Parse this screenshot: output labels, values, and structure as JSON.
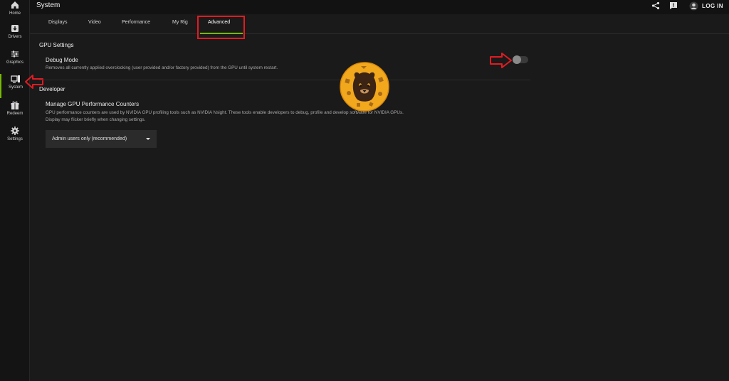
{
  "sidebar": {
    "items": [
      {
        "label": "Home",
        "icon": "home-icon"
      },
      {
        "label": "Drivers",
        "icon": "drivers-icon"
      },
      {
        "label": "Graphics",
        "icon": "sliders-icon"
      },
      {
        "label": "System",
        "icon": "system-icon",
        "active": true
      },
      {
        "label": "Redeem",
        "icon": "gift-icon"
      },
      {
        "label": "Settings",
        "icon": "gear-icon"
      }
    ]
  },
  "header": {
    "title": "System",
    "login_label": "LOG IN",
    "icons": [
      "share-icon",
      "feedback-icon",
      "user-icon"
    ]
  },
  "tabs": [
    {
      "label": "Displays"
    },
    {
      "label": "Video"
    },
    {
      "label": "Performance"
    },
    {
      "label": "My Rig"
    },
    {
      "label": "Advanced",
      "active": true
    }
  ],
  "gpu_settings": {
    "section_title": "GPU Settings",
    "debug_mode": {
      "title": "Debug Mode",
      "description": "Removes all currently applied overclocking (user provided and/or factory provided) from the GPU until system restart.",
      "enabled": false
    }
  },
  "developer": {
    "section_title": "Developer",
    "counters": {
      "title": "Manage GPU Performance Counters",
      "description_line1": "GPU performance counters are used by NVIDIA GPU profiling tools such as NVIDIA Nsight. These tools enable developers to debug, profile and develop software for NVIDIA GPUs.",
      "description_line2": "Display may flicker briefly when changing settings.",
      "selected_option": "Admin users only (recommended)"
    }
  },
  "colors": {
    "accent": "#76b900",
    "annotation_red": "#e11b22",
    "background": "#1a1a1a"
  }
}
